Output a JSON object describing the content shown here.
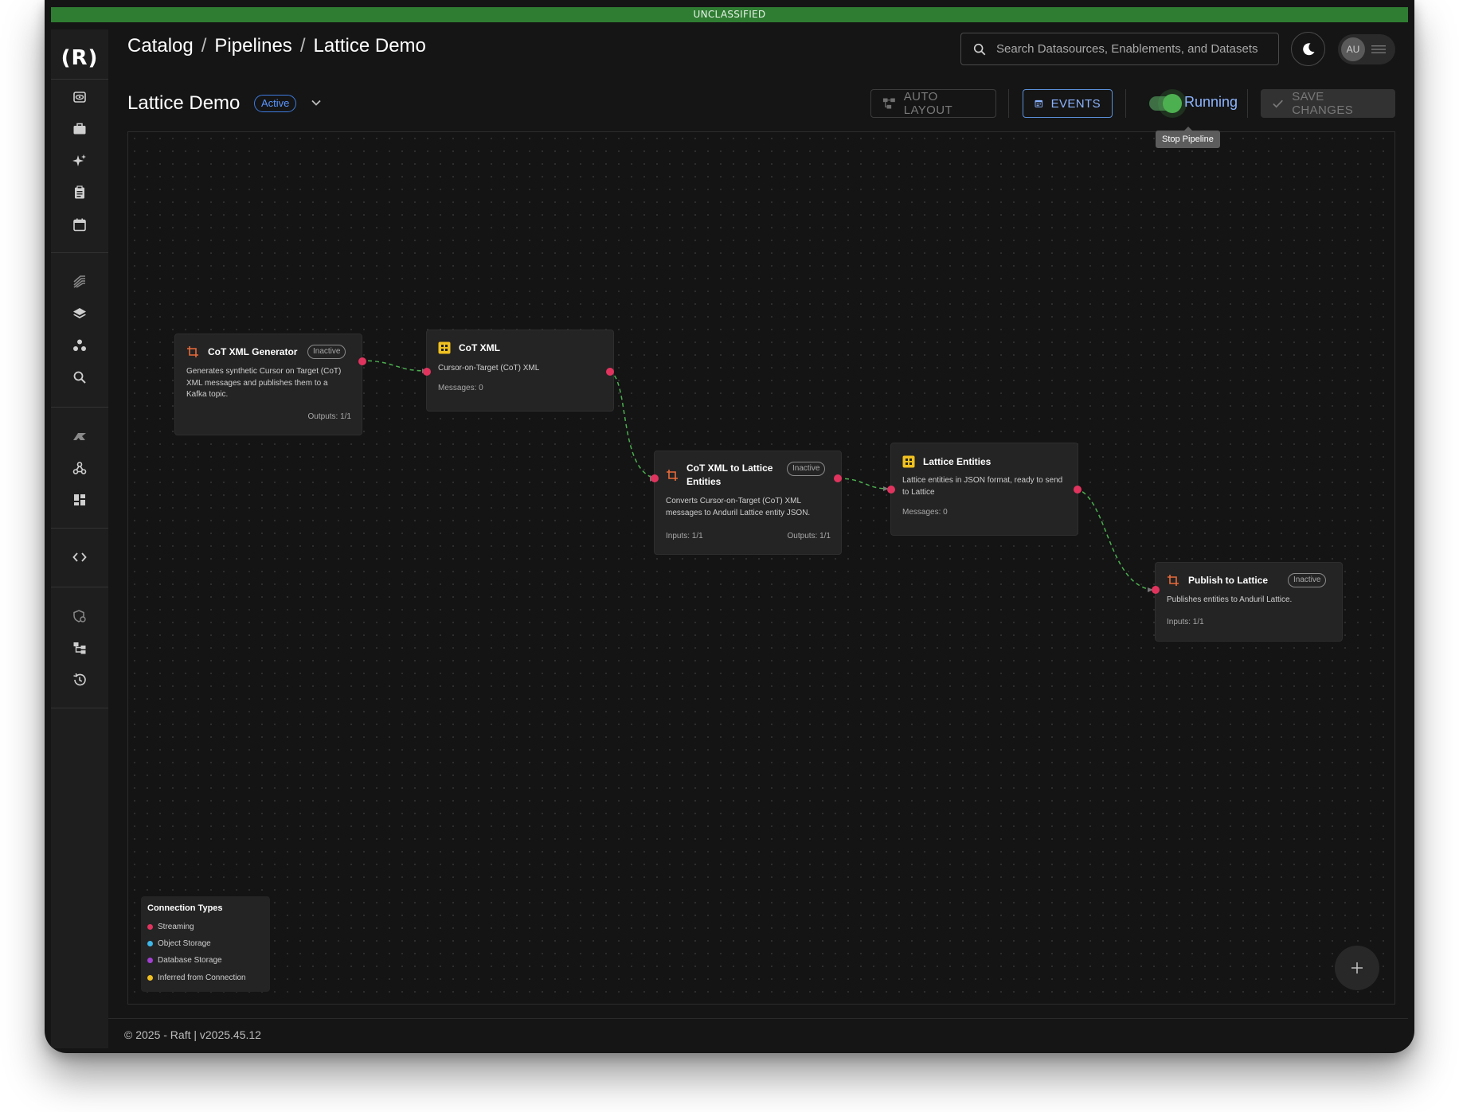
{
  "classification": "UNCLASSIFIED",
  "breadcrumb": [
    "Catalog",
    "Pipelines",
    "Lattice Demo"
  ],
  "breadcrumb_separator": "/",
  "search": {
    "placeholder": "Search Datasources, Enablements, and Datasets"
  },
  "user": {
    "initials": "AU"
  },
  "page": {
    "title": "Lattice Demo",
    "status": "Active"
  },
  "toolbar": {
    "auto_layout": "AUTO LAYOUT",
    "events": "EVENTS",
    "running_label": "Running",
    "save_changes": "SAVE CHANGES",
    "tooltip": "Stop Pipeline"
  },
  "sidebar": {
    "logo": "(R)",
    "icons": [
      "eye-icon",
      "briefcase-icon",
      "sparkles-icon",
      "clipboard-icon",
      "calendar-icon",
      "stack-lines-icon",
      "layers-icon",
      "nodes-icon",
      "search-icon",
      "anduril-icon",
      "webhook-icon",
      "dashboard-icon",
      "code-icon",
      "shield-icon",
      "hierarchy-icon",
      "history-icon"
    ]
  },
  "nodes": {
    "generator": {
      "title": "CoT XML Generator",
      "status": "Inactive",
      "description": "Generates synthetic Cursor on Target (CoT) XML messages and publishes them to a Kafka topic.",
      "outputs": "Outputs: 1/1"
    },
    "cot_xml": {
      "title": "CoT XML",
      "description": "Cursor-on-Target (CoT) XML",
      "messages": "Messages: 0"
    },
    "transform": {
      "title": "CoT XML to Lattice Entities",
      "status": "Inactive",
      "description": "Converts Cursor-on-Target (CoT) XML messages to Anduril Lattice entity JSON.",
      "inputs": "Inputs: 1/1",
      "outputs": "Outputs: 1/1"
    },
    "lattice_entities": {
      "title": "Lattice Entities",
      "description": "Lattice entities in JSON format, ready to send to Lattice",
      "messages": "Messages: 0"
    },
    "publish": {
      "title": "Publish to Lattice",
      "status": "Inactive",
      "description": "Publishes entities to Anduril Lattice.",
      "inputs": "Inputs: 1/1"
    }
  },
  "legend": {
    "title": "Connection Types",
    "items": [
      {
        "label": "Streaming",
        "color": "#e0345e"
      },
      {
        "label": "Object Storage",
        "color": "#3fb6e8"
      },
      {
        "label": "Database Storage",
        "color": "#a23fd0"
      },
      {
        "label": "Inferred from Connection",
        "color": "#f0c020"
      }
    ]
  },
  "colors": {
    "accent_blue": "#5b96ff",
    "classification_green": "#2f7d32",
    "edge_green": "#4caf50",
    "port_red": "#e0345e",
    "transform_orange": "#e86a3a",
    "dataset_yellow": "#f0c020"
  },
  "footer": {
    "copyright": "© 2025 - Raft",
    "version": "| v2025.45.12"
  }
}
